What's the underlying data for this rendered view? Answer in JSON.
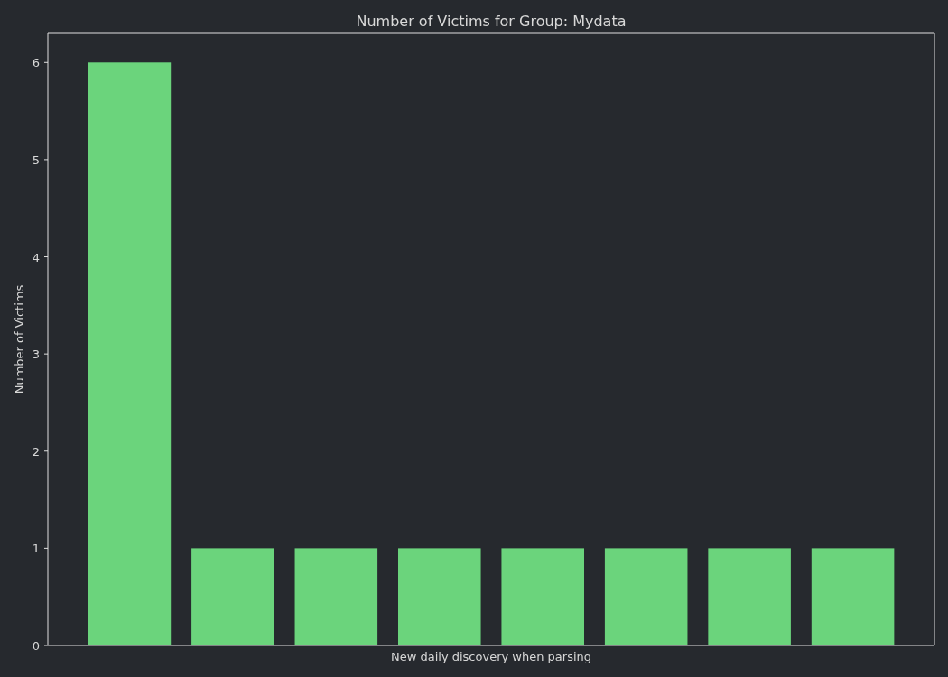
{
  "chart_data": {
    "type": "bar",
    "title": "Number of Victims for Group: Mydata",
    "xlabel": "New daily discovery when parsing",
    "ylabel": "Number of Victims",
    "categories": [
      null,
      null,
      null,
      null,
      null,
      null,
      null,
      null
    ],
    "values": [
      6,
      1,
      1,
      1,
      1,
      1,
      1,
      1
    ],
    "ylim": [
      0,
      6.3
    ],
    "yticks": [
      {
        "value": 0,
        "label": "0"
      },
      {
        "value": 1,
        "label": "1"
      },
      {
        "value": 2,
        "label": "2"
      },
      {
        "value": 3,
        "label": "3"
      },
      {
        "value": 4,
        "label": "4"
      },
      {
        "value": 5,
        "label": "5"
      },
      {
        "value": 6,
        "label": "6"
      }
    ]
  }
}
